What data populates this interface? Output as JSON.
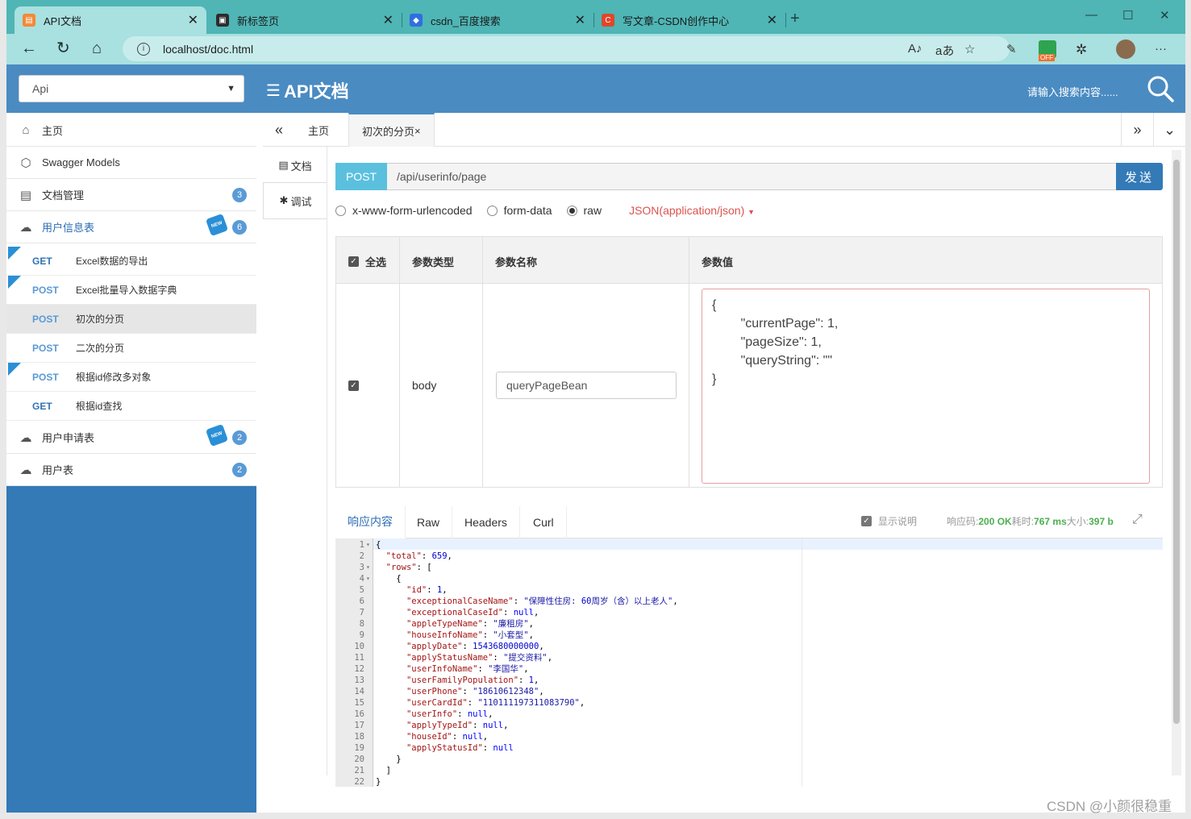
{
  "browser": {
    "tabs": [
      {
        "title": "API文档",
        "icon_color": "#f28a35"
      },
      {
        "title": "新标签页",
        "icon_color": "#2c2c2c"
      },
      {
        "title": "csdn_百度搜索",
        "icon_color": "#2f6fe0"
      },
      {
        "title": "写文章-CSDN创作中心",
        "icon_color": "#e0472b"
      }
    ],
    "url": "localhost/doc.html",
    "ext_badge": "OFF"
  },
  "header": {
    "group_select": "Api",
    "title": "API文档",
    "search_placeholder": "请输入搜索内容......"
  },
  "sidebar": {
    "items": [
      {
        "label": "主页",
        "icon": "home-icon"
      },
      {
        "label": "Swagger Models",
        "icon": "cube-icon"
      },
      {
        "label": "文档管理",
        "icon": "doc-icon",
        "badge": "3"
      },
      {
        "label": "用户信息表",
        "icon": "cloud-icon",
        "badge": "6",
        "new": "NEW"
      }
    ],
    "apis": [
      {
        "method": "GET",
        "label": "Excel数据的导出"
      },
      {
        "method": "POST",
        "label": "Excel批量导入数据字典"
      },
      {
        "method": "POST",
        "label": "初次的分页"
      },
      {
        "method": "POST",
        "label": "二次的分页"
      },
      {
        "method": "POST",
        "label": "根据id修改多对象"
      },
      {
        "method": "GET",
        "label": "根据id查找"
      }
    ],
    "groups": [
      {
        "label": "用户申请表",
        "badge": "2",
        "new": "NEW"
      },
      {
        "label": "用户表",
        "badge": "2"
      }
    ]
  },
  "tabs": {
    "home": "主页",
    "current": "初次的分页",
    "close": "×"
  },
  "inner_tabs": {
    "doc": "文档",
    "debug": "调试"
  },
  "request": {
    "method": "POST",
    "path": "/api/userinfo/page",
    "send": "发送",
    "body_types": [
      "x-www-form-urlencoded",
      "form-data",
      "raw"
    ],
    "content_type": "JSON(application/json)"
  },
  "params": {
    "headers": {
      "select_all": "全选",
      "type": "参数类型",
      "name": "参数名称",
      "value": "参数值"
    },
    "row": {
      "type": "body",
      "name": "queryPageBean",
      "value": "{\n        \"currentPage\": 1,\n        \"pageSize\": 1,\n        \"queryString\": \"\"\n}"
    }
  },
  "response": {
    "tabs": [
      "响应内容",
      "Raw",
      "Headers",
      "Curl"
    ],
    "show_desc": "显示说明",
    "code_label": "响应码:",
    "code": "200 OK",
    "time_label": "耗时:",
    "time": "767 ms",
    "size_label": "大小:",
    "size": "397 b",
    "lines": [
      "{",
      "  \"total\": 659,",
      "  \"rows\": [",
      "    {",
      "      \"id\": 1,",
      "      \"exceptionalCaseName\": \"保障性住房:60周岁（含）以上老人\",",
      "      \"exceptionalCaseId\": null,",
      "      \"appleTypeName\": \"廉租房\",",
      "      \"houseInfoName\": \"小套型\",",
      "      \"applyDate\": 1543680000000,",
      "      \"applyStatusName\": \"提交资料\",",
      "      \"userInfoName\": \"李国华\",",
      "      \"userFamilyPopulation\": 1,",
      "      \"userPhone\": \"18610612348\",",
      "      \"userCardId\": \"110111197311083790\",",
      "      \"userInfo\": null,",
      "      \"applyTypeId\": null,",
      "      \"houseId\": null,",
      "      \"applyStatusId\": null",
      "    }",
      "  ]",
      "}"
    ]
  },
  "watermark": "CSDN @小颜很稳重"
}
